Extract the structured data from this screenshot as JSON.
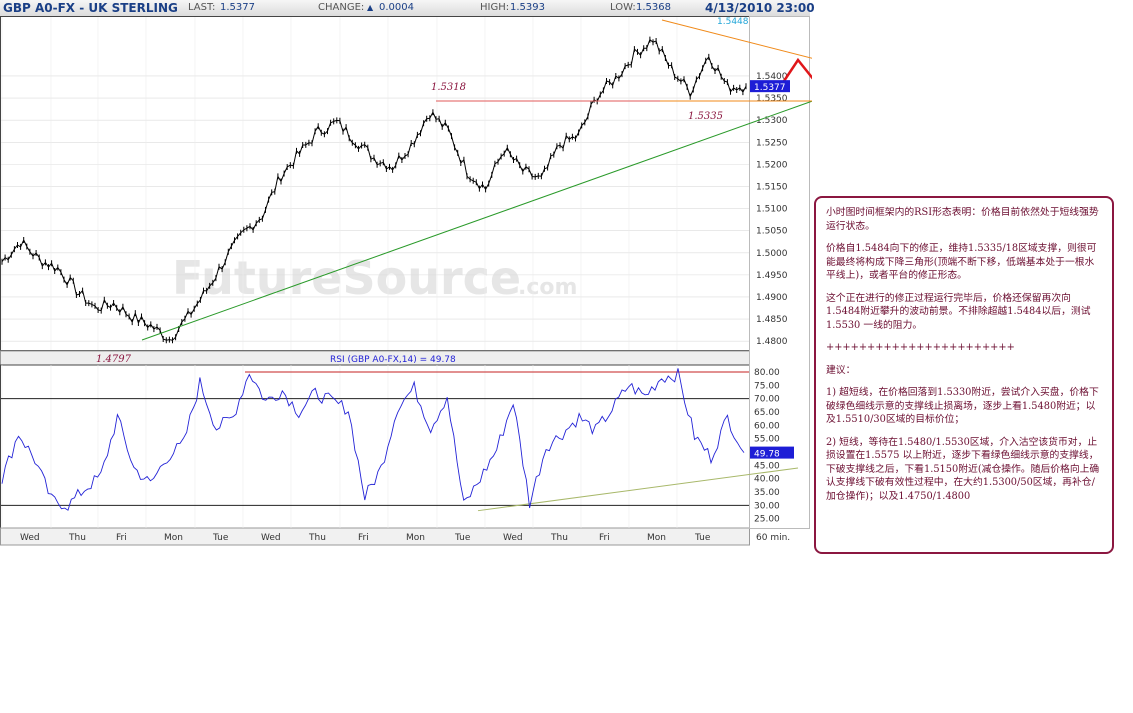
{
  "header": {
    "symbol": "GBP A0-FX - UK STERLING",
    "last_label": "LAST:",
    "last": "1.5377",
    "change_label": "CHANGE:",
    "change_arrow": "▲",
    "change": "0.0004",
    "high_label": "HIGH:",
    "high": "1.5393",
    "low_label": "LOW:",
    "low": "1.5368",
    "datetime": "4/13/2010 23:00"
  },
  "watermark": "FutureSource",
  "watermark_suffix": ".com",
  "chart_data": [
    {
      "type": "line",
      "title": "GBP A0-FX - UK STERLING",
      "interval": "60 min.",
      "ylim": [
        1.478,
        1.55
      ],
      "y_ticks": [
        "1.5400",
        "1.5350",
        "1.5300",
        "1.5250",
        "1.5200",
        "1.5150",
        "1.5100",
        "1.5050",
        "1.5000",
        "1.4950",
        "1.4900",
        "1.4850",
        "1.4800"
      ],
      "x_labels": [
        "Wed",
        "Thu",
        "Fri",
        "Mon",
        "Tue",
        "Wed",
        "Thu",
        "Fri",
        "Mon",
        "Tue",
        "Wed",
        "Thu",
        "Fri",
        "Mon",
        "Tue"
      ],
      "series": [
        {
          "values": [
            1.498,
            1.5025,
            1.4985,
            1.4965,
            1.4915,
            1.4875,
            1.4885,
            1.4855,
            1.4835,
            1.4805,
            1.4855,
            1.4915,
            1.4985,
            1.5045,
            1.5085,
            1.5175,
            1.5225,
            1.5275,
            1.5295,
            1.5255,
            1.5215,
            1.5195,
            1.5245,
            1.5318,
            1.5275,
            1.5185,
            1.5145,
            1.5235,
            1.5185,
            1.5165,
            1.5245,
            1.5265,
            1.5355,
            1.5395,
            1.5448,
            1.5484,
            1.5415,
            1.5365,
            1.5448,
            1.5375,
            1.5377
          ]
        }
      ],
      "last_value_label": "1.5377",
      "annotations": [
        "1.5318",
        "1.5335",
        "1.5484",
        "1.5448",
        "1.4797"
      ],
      "trendlines": [
        "green rising support",
        "orange falling resistance",
        "red horizontal 1.5318"
      ]
    },
    {
      "type": "line",
      "title": "RSI (GBP A0-FX,14) = 49.78",
      "ylim": [
        25,
        82
      ],
      "y_ticks": [
        "80.00",
        "75.00",
        "70.00",
        "65.00",
        "60.00",
        "55.00",
        "50.00",
        "45.00",
        "40.00",
        "35.00",
        "30.00",
        "25.00"
      ],
      "reference_lines": [
        70,
        30
      ],
      "series": [
        {
          "values": [
            40,
            57,
            47,
            32,
            30,
            36,
            41,
            63,
            44,
            38,
            48,
            53,
            76,
            59,
            63,
            80,
            69,
            73,
            65,
            72,
            69,
            66,
            33,
            44,
            67,
            74,
            59,
            71,
            30,
            40,
            51,
            69,
            31,
            52,
            57,
            63,
            58,
            66,
            75,
            71,
            78,
            79,
            56,
            48,
            63,
            49.78
          ]
        }
      ],
      "last_value_label": "49.78"
    }
  ],
  "note": {
    "p1": "小时图时间框架内的RSI形态表明：价格目前依然处于短线强势运行状态。",
    "p2": "价格自1.5484向下的修正，维持1.5335/18区域支撑，则很可能最终将构成下降三角形(顶端不断下移，低端基本处于一根水平线上)，或者平台的修正形态。",
    "p3": "这个正在进行的修正过程运行完毕后，价格还保留再次向1.5484附近攀升的波动前景。不排除超越1.5484以后，测试 1.5530 一线的阻力。",
    "p4": "+++++++++++++++++++++++",
    "p5": "建议：",
    "p6": "1) 超短线，在价格回落到1.5330附近，尝试介入买盘，价格下破绿色细线示意的支撑线止损离场，逐步上看1.5480附近；以及1.5510/30区域的目标价位；",
    "p7": "2) 短线，等待在1.5480/1.5530区域，介入沽空该货币对，止损设置在1.5575 以上附近，逐步下看绿色细线示意的支撑线，下破支撑线之后，下看1.5150附近(减仓操作。随后价格向上确认支撑线下破有效性过程中，在大约1.5300/50区域，再补仓/加仓操作)；以及1.4750/1.4800"
  },
  "colors": {
    "price": "#000000",
    "rsi": "#2323d6",
    "support": "#2a9a2a",
    "resistance": "#f08a1a",
    "hline": "#e05a5a",
    "projection": "#e0161a",
    "label": "#8b1740",
    "axis_text": "#333333",
    "tag_bg": "#1d1dd6",
    "rsi_support": "#a8b86a",
    "panel_border": "#8b1740"
  }
}
